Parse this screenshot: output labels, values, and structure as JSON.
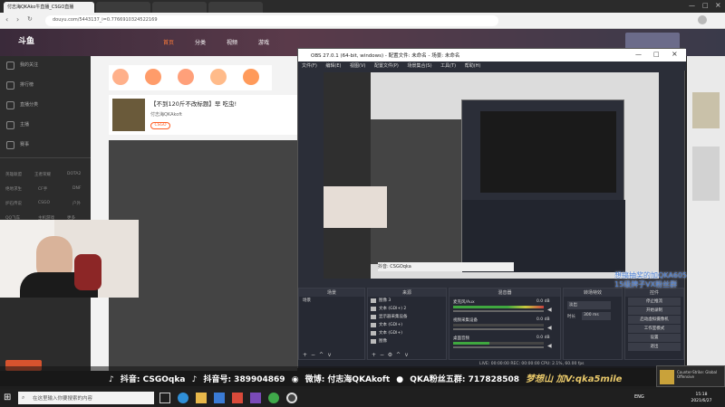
{
  "browser": {
    "tabs": [
      "付志海QKAko牛直播_CSGO直播",
      "",
      "",
      "",
      ""
    ],
    "url": "douyu.com/5443137_i=0.7766910324522169"
  },
  "sidebar": {
    "items": [
      "我的关注",
      "排行榜",
      "直播分类",
      "主播",
      "赛事"
    ],
    "categories": [
      "英雄联盟",
      "王者荣耀",
      "DOTA2",
      "绝地求生",
      "CF手",
      "DNF",
      "炉石传说",
      "CSGO",
      "户外",
      "QQ飞车",
      "主机游戏",
      "更多"
    ]
  },
  "stream": {
    "title": "【不到120斤不改标题】早 吃虫!",
    "streamer": "付志海QKAkoft",
    "tag": "CSGO"
  },
  "obs": {
    "title": "OBS 27.0.1 (64-bit, windows) - 配置文件: 未命名 - 场景: 未命名",
    "menu": [
      "文件(F)",
      "编辑(E)",
      "视图(V)",
      "配置文件(P)",
      "场景集合(S)",
      "工具(T)",
      "帮助(H)"
    ],
    "dock_scenes": "场景",
    "dock_sources": "来源",
    "dock_mixer": "混音器",
    "dock_transitions": "转场特效",
    "dock_controls": "控件",
    "scene_item": "场景",
    "sources": [
      "图像 3",
      "文本 (GDI+) 2",
      "显示器采集设备",
      "文本 (GDI+)",
      "文本 (GDI+)",
      "图像"
    ],
    "mixer": [
      "麦克风/Aux",
      "视频采集设备",
      "桌面音频"
    ],
    "mixer_db": [
      "0.0 dB",
      "0.0 dB",
      "0.0 dB"
    ],
    "transition_type": "淡出",
    "duration_label": "时长",
    "duration": "300 ms",
    "controls": [
      "停止推流",
      "开始录制",
      "启动虚拟摄像机",
      "工作室模式",
      "设置",
      "退出"
    ],
    "status_bar": "LIVE: 00:00:00  REC: 00:00:00  CPU: 2.1%, 60.00 fps"
  },
  "overlay": {
    "line1": "想搞抽奖的加QKA605",
    "line2": "15级牌子VX粉丝群"
  },
  "banner": {
    "tiktok": "抖音: CSGOqka",
    "tiktok_id": "抖音号: 389904869",
    "weibo": "微博: 付志海QKAkoft",
    "fans_group": "QKA粉丝五群: 717828508",
    "dream": "梦想山 加V:qka5mile"
  },
  "taskbar": {
    "search": "在这里输入你要搜索的内容",
    "time": "15:18",
    "date": "2021/6/27",
    "lang": "ENG",
    "notification": "Counter-Strike: Global Offensive"
  },
  "colors": {
    "accent": "#ff5d23",
    "obs_bg": "#2b2e38",
    "overlay_blue": "#4a7fd6"
  }
}
